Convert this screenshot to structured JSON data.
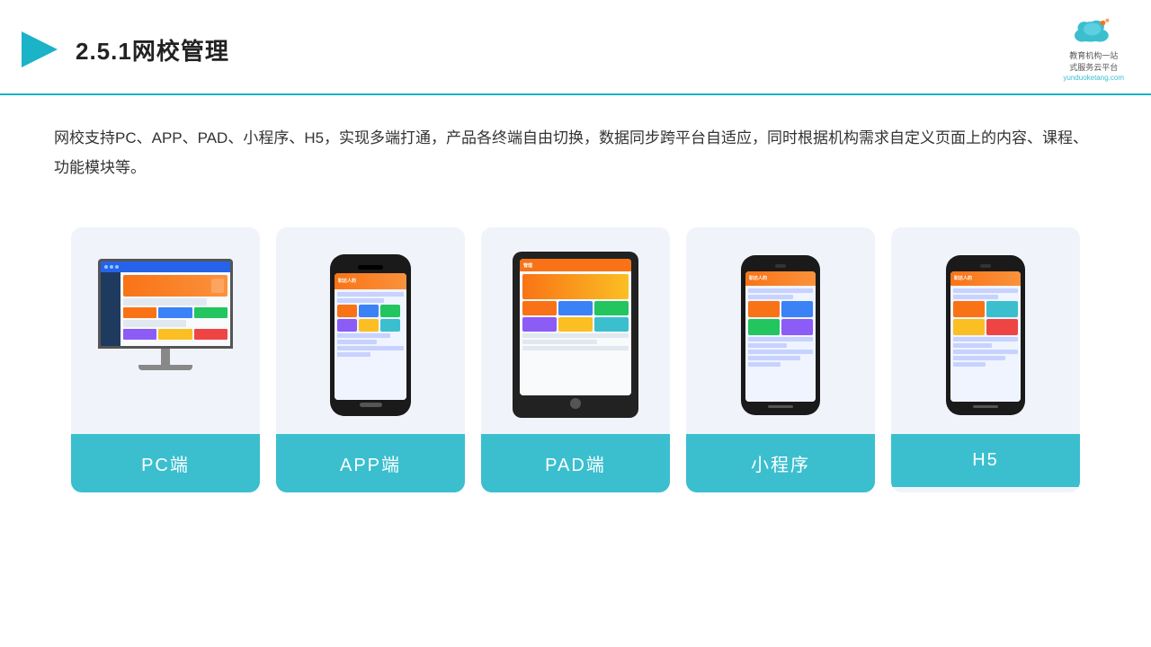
{
  "header": {
    "title": "2.5.1网校管理",
    "logo_line1": "教育机构一站",
    "logo_line2": "式服务云平台",
    "logo_sub": "yunduoketang.com"
  },
  "description": "网校支持PC、APP、PAD、小程序、H5，实现多端打通，产品各终端自由切换，数据同步跨平台自适应，同时根据机构需求自定义页面上的内容、课程、功能模块等。",
  "cards": [
    {
      "id": "pc",
      "label": "PC端"
    },
    {
      "id": "app",
      "label": "APP端"
    },
    {
      "id": "pad",
      "label": "PAD端"
    },
    {
      "id": "miniprogram",
      "label": "小程序"
    },
    {
      "id": "h5",
      "label": "H5"
    }
  ]
}
